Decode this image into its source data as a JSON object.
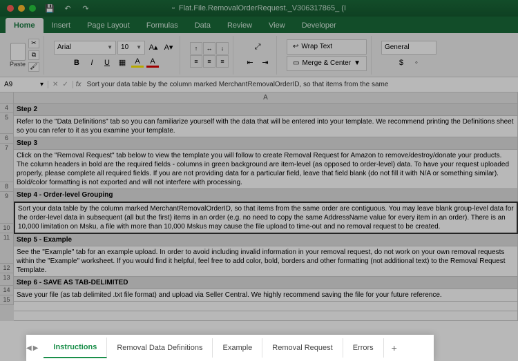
{
  "titlebar": {
    "filename": "Flat.File.RemovalOrderRequest._V306317865_  (I"
  },
  "ribbon_tabs": [
    "Home",
    "Insert",
    "Page Layout",
    "Formulas",
    "Data",
    "Review",
    "View",
    "Developer"
  ],
  "ribbon": {
    "paste_label": "Paste",
    "font_name": "Arial",
    "font_size": "10",
    "wrap_text": "Wrap Text",
    "merge_center": "Merge & Center",
    "number_format": "General"
  },
  "formula_bar": {
    "cell_ref": "A9",
    "fx": "fx",
    "content": "Sort your data table by the column marked MerchantRemovalOrderID, so that items from the same"
  },
  "column_letter": "A",
  "row_numbers": [
    "4",
    "5",
    "6",
    "7",
    "8",
    "9",
    "10",
    "11",
    "12",
    "13",
    "14",
    "15"
  ],
  "steps": {
    "s2_head": "Step 2",
    "s2_body": "Refer to the \"Data Definitions\" tab so you can familiarize yourself with the data that will be entered into your template.  We recommend printing the Definitions sheet so you can refer to it as you examine your template.",
    "s3_head": "Step 3",
    "s3_body": "Click on the \"Removal Request\" tab below to view the template you will follow to create Removal Request for Amazon to remove/destroy/donate your products. The column headers in bold are the required fields - columns in green background are item-level (as opposed to order-level) data. To have your request uploaded properly, please complete all required fields.  If you are not providing data for a particular field, leave that field blank (do not fill it with N/A or something similar).   Bold/color formatting is not exported and will not interfere with processing.",
    "s4_head": "Step 4 - Order-level Grouping",
    "s4_body": "Sort your data table by the column marked MerchantRemovalOrderID, so that items from the same order are contiguous.  You may leave blank group-level data for the order-level data in subsequent (all but the first) items in an order (e.g. no need to copy the same AddressName value for every item in an order).  There is an 10,000 limitation on Msku, a file with more than 10,000 Mskus may cause the file upload to time-out and no removal request to be created.",
    "s5_head": "Step 5 - Example",
    "s5_body": "See the \"Example\" tab for an example upload.  In order to avoid including invalid information in your removal request, do not work on your own removal requests within the \"Example\" worksheet. If you would find it helpful, feel free to add color, bold, borders and other formatting (not additional text) to the Removal Request Template.",
    "s6_head": "Step 6 - SAVE AS TAB-DELIMITED",
    "s6_body": "Save your file (as tab delimited .txt file format) and upload via Seller Central.  We highly recommend saving the file for your future reference."
  },
  "sheet_tabs": [
    "Instructions",
    "Removal Data Definitions",
    "Example",
    "Removal Request",
    "Errors"
  ],
  "add_tab_label": "+"
}
